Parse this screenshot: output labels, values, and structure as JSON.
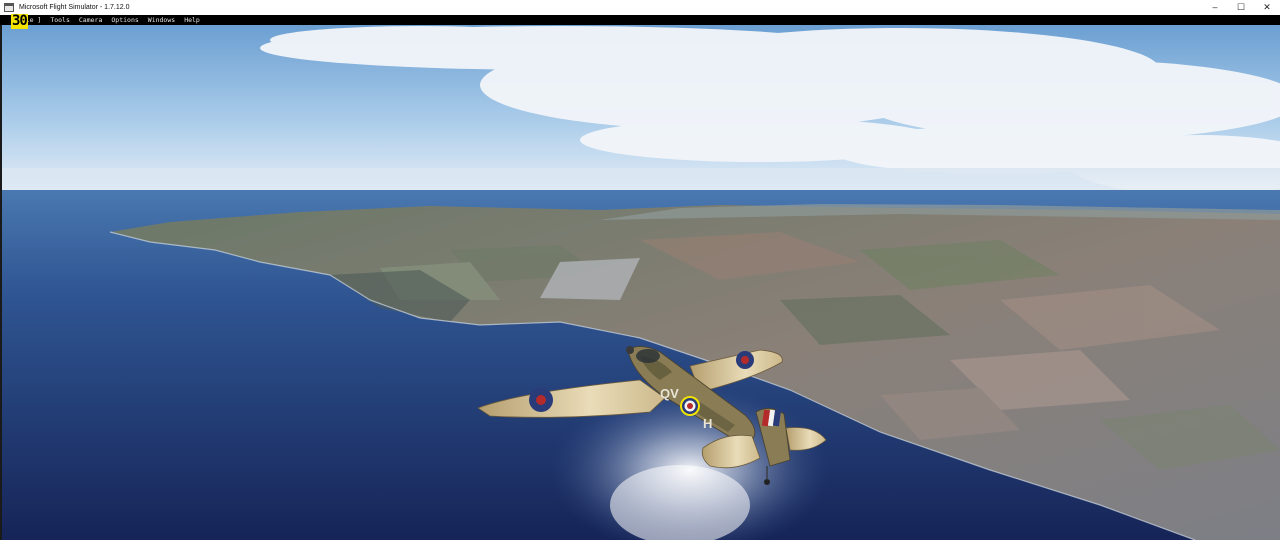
{
  "window": {
    "title": "Microsoft Flight Simulator - 1.7.12.0",
    "controls": {
      "minimize": "–",
      "maximize": "☐",
      "close": "✕"
    }
  },
  "menubar": {
    "items": [
      "[ File ]",
      "Tools",
      "Camera",
      "Options",
      "Windows",
      "Help"
    ]
  },
  "fps_counter": "30",
  "aircraft": {
    "fuselage_code": "QV",
    "tail_letter": "H"
  },
  "colors": {
    "menubar_bg": "#000000",
    "fps_bg": "#f2e400",
    "sky_top": "#6fa6d8",
    "sea_deep": "#1b2a5c"
  }
}
